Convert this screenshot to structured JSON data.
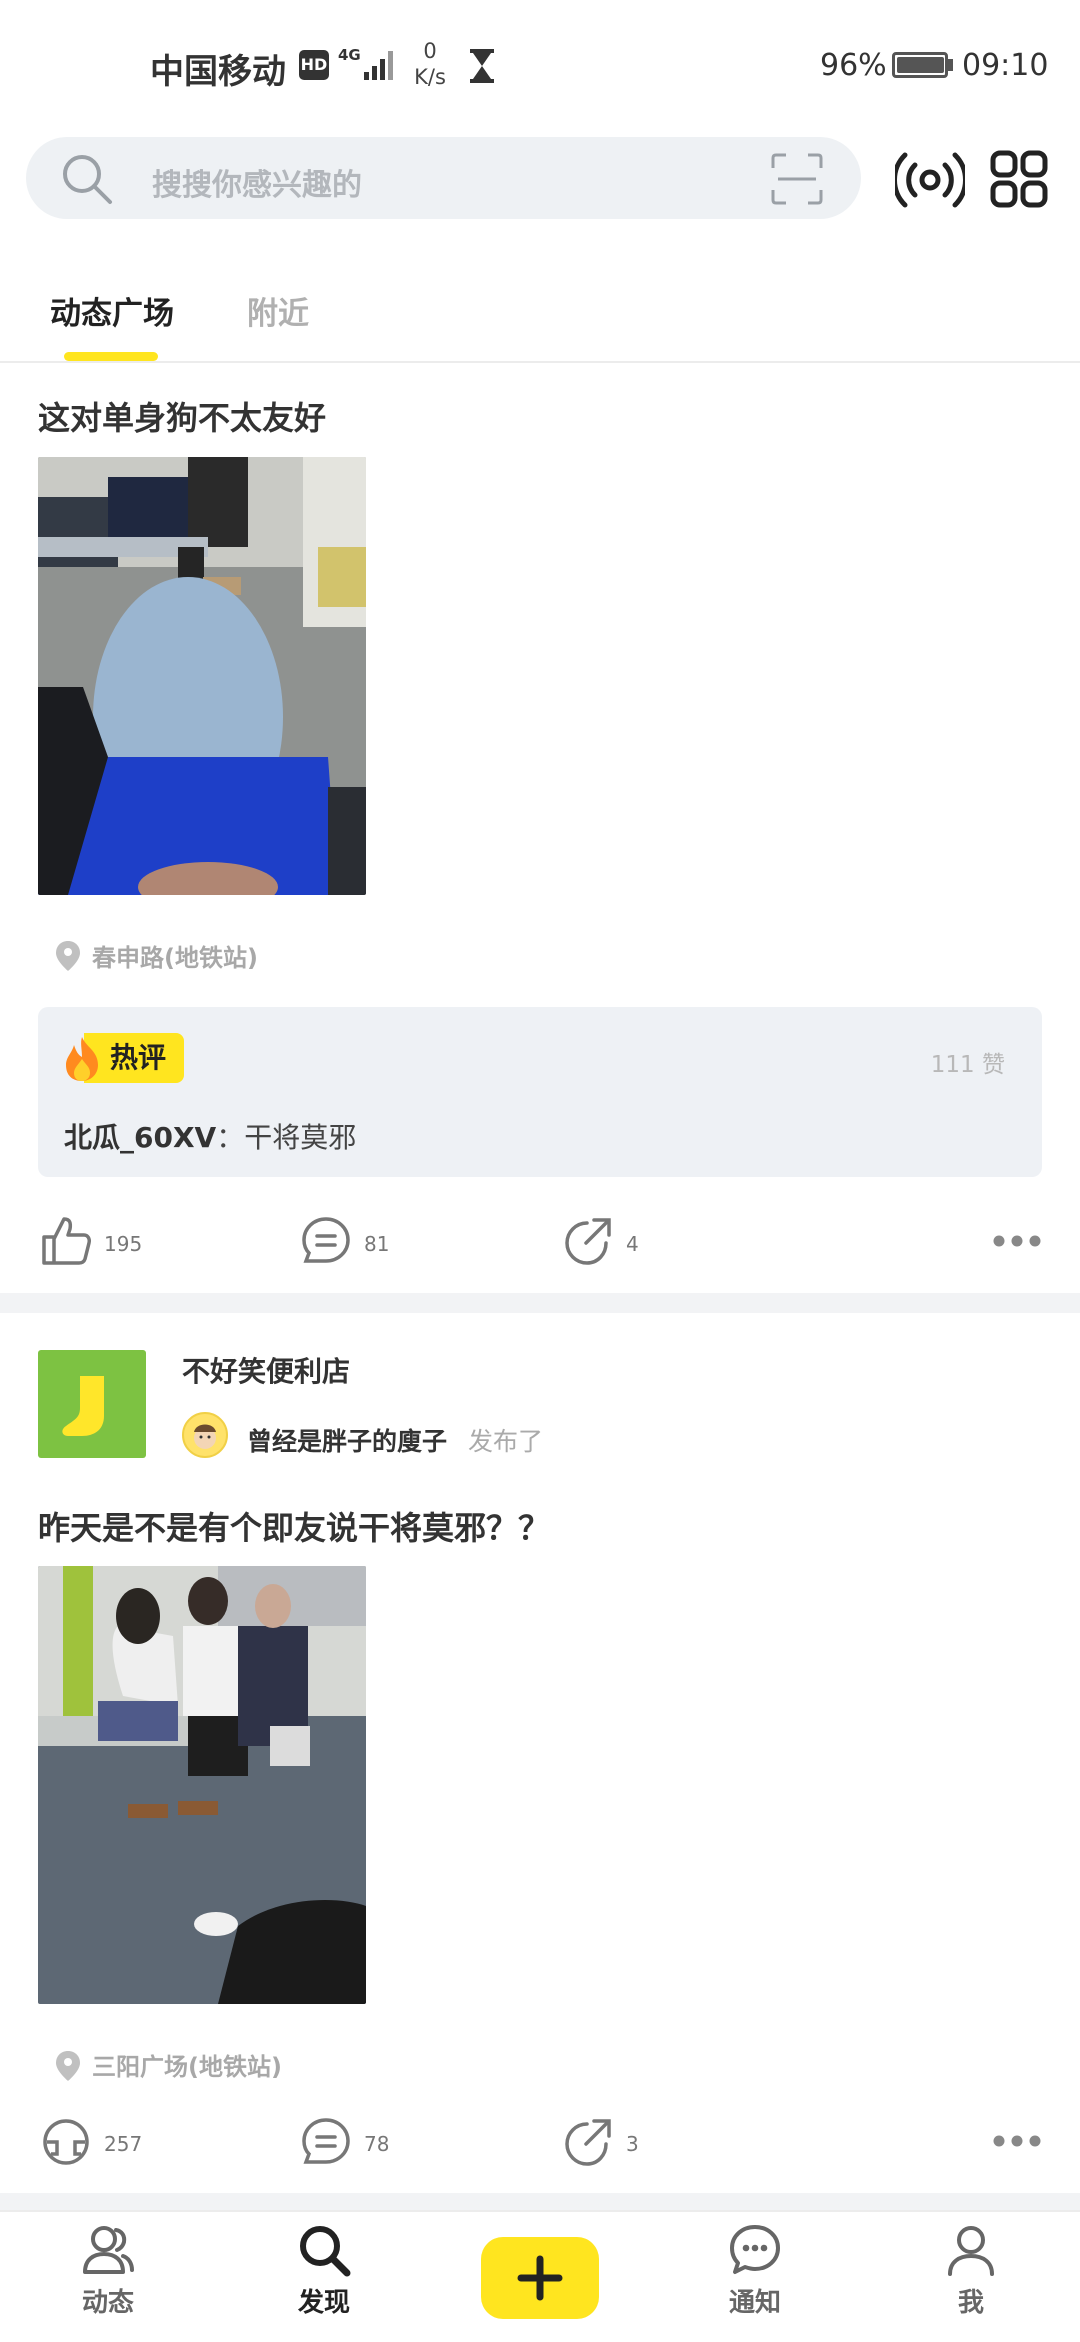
{
  "status_bar": {
    "carrier": "中国移动",
    "hd_badge": "HD",
    "network": "4G",
    "speed_value": "0",
    "speed_unit": "K/s",
    "battery_percent": "96%",
    "battery_level": 0.96,
    "time": "09:10"
  },
  "search": {
    "placeholder": "搜搜你感兴趣的"
  },
  "tabs": [
    {
      "label": "动态广场",
      "active": true
    },
    {
      "label": "附近",
      "active": false
    }
  ],
  "posts": [
    {
      "title": "这对单身狗不太友好",
      "location": "春申路(地铁站)",
      "hot_comment": {
        "badge": "热评",
        "likes": "111 赞",
        "user": "北瓜_60XV",
        "separator": "：",
        "text": "干将莫邪"
      },
      "actions": {
        "likes": "195",
        "comments": "81",
        "shares": "4"
      }
    },
    {
      "shop": "不好笑便利店",
      "author": "曾经是胖子的廋子",
      "published": "发布了",
      "title": "昨天是不是有个即友说干将莫邪？？",
      "location": "三阳广场(地铁站)",
      "actions": {
        "likes": "257",
        "comments": "78",
        "shares": "3"
      }
    }
  ],
  "bottom_nav": [
    {
      "label": "动态",
      "icon": "people-icon"
    },
    {
      "label": "发现",
      "icon": "search-icon",
      "active": true
    },
    {
      "label": "",
      "icon": "plus-icon"
    },
    {
      "label": "通知",
      "icon": "chat-icon"
    },
    {
      "label": "我",
      "icon": "person-icon"
    }
  ],
  "colors": {
    "accent": "#ffe51f",
    "shop_logo": "#7dc242",
    "search_bg": "#eef1f4"
  }
}
